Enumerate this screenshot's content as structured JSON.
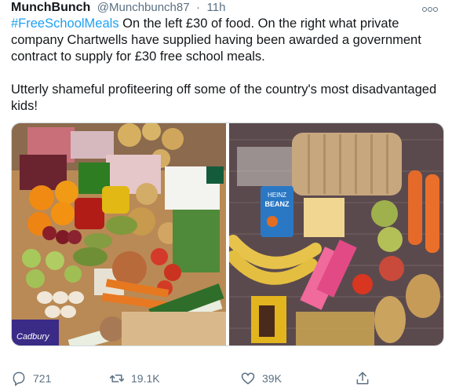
{
  "tweet": {
    "author": "MunchBunch",
    "handle": "@Munchbunch87",
    "separator": "·",
    "time": "11h",
    "hashtag": "#FreeSchoolMeals",
    "text_part1": " On the left £30 of food. On the right what private company Chartwells have supplied having been awarded a government contract to supply for £30 free school meals.",
    "text_part2": "Utterly shameful profiteering off some of the country's most disadvantaged kids!"
  },
  "media": {
    "left_photo": {
      "label_biscuits": "Cadbury",
      "label_milk_cap": ""
    },
    "right_photo": {
      "beans_label_line1": "HEINZ",
      "beans_label_line2": "BEANZ"
    }
  },
  "actions": {
    "reply_count": "721",
    "retweet_count": "19.1K",
    "like_count": "39K"
  },
  "colors": {
    "link": "#1da1f2",
    "secondary_text": "#5b7083"
  }
}
